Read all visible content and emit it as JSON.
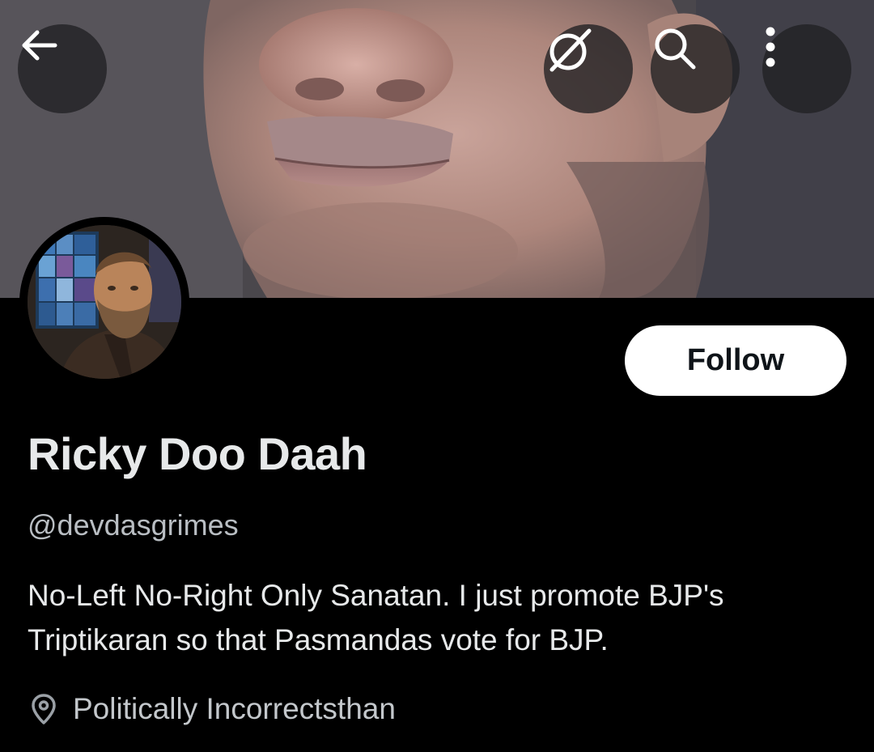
{
  "header": {
    "icons": {
      "back": "arrow-left-icon",
      "grok": "grok-icon",
      "search": "search-icon",
      "more": "more-vertical-icon"
    }
  },
  "profile": {
    "display_name": "Ricky Doo Daah",
    "handle": "@devdasgrimes",
    "bio": "No-Left No-Right Only Sanatan. I just promote BJP's Triptikaran so that Pasmandas vote for BJP.",
    "location": "Politically Incorrectsthan",
    "location_icon": "location-pin-icon"
  },
  "actions": {
    "follow_label": "Follow"
  },
  "colors": {
    "background": "#000000",
    "text_primary": "#e7e9ea",
    "text_secondary": "#b9bec3",
    "follow_bg": "#ffffff",
    "follow_text": "#0f1419"
  }
}
